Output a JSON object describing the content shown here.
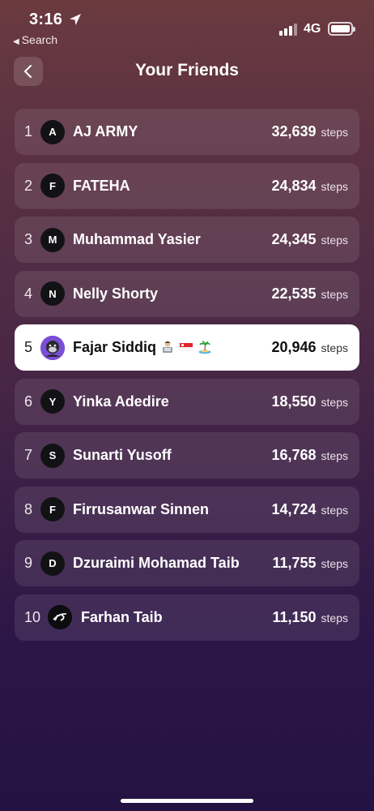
{
  "status": {
    "time": "3:16",
    "back_app": "Search",
    "network": "4G"
  },
  "header": {
    "title": "Your Friends"
  },
  "unit_label": "steps",
  "friends": [
    {
      "rank": "1",
      "initial": "A",
      "name": "AJ ARMY",
      "steps": "32,639"
    },
    {
      "rank": "2",
      "initial": "F",
      "name": "FATEHA",
      "steps": "24,834"
    },
    {
      "rank": "3",
      "initial": "M",
      "name": "Muhammad Yasier",
      "steps": "24,345"
    },
    {
      "rank": "4",
      "initial": "N",
      "name": "Nelly Shorty",
      "steps": "22,535"
    },
    {
      "rank": "5",
      "initial": "",
      "name": "Fajar Siddiq",
      "steps": "20,946",
      "highlight": true,
      "badges": [
        "technologist-emoji",
        "singapore-flag-emoji",
        "desert-island-emoji"
      ]
    },
    {
      "rank": "6",
      "initial": "Y",
      "name": "Yinka Adedire",
      "steps": "18,550"
    },
    {
      "rank": "7",
      "initial": "S",
      "name": "Sunarti Yusoff",
      "steps": "16,768"
    },
    {
      "rank": "8",
      "initial": "F",
      "name": "Firrusanwar Sinnen",
      "steps": "14,724"
    },
    {
      "rank": "9",
      "initial": "D",
      "name": "Dzuraimi Mohamad Taib",
      "steps": "11,755"
    },
    {
      "rank": "10",
      "initial": "",
      "name": "Farhan Taib",
      "steps": "11,150"
    }
  ],
  "colors": {
    "highlight_bg": "#ffffff",
    "row_bg": "rgba(255,255,255,0.09)",
    "avatar_bg": "#121214",
    "fajar_avatar": "#7a4fd6"
  }
}
